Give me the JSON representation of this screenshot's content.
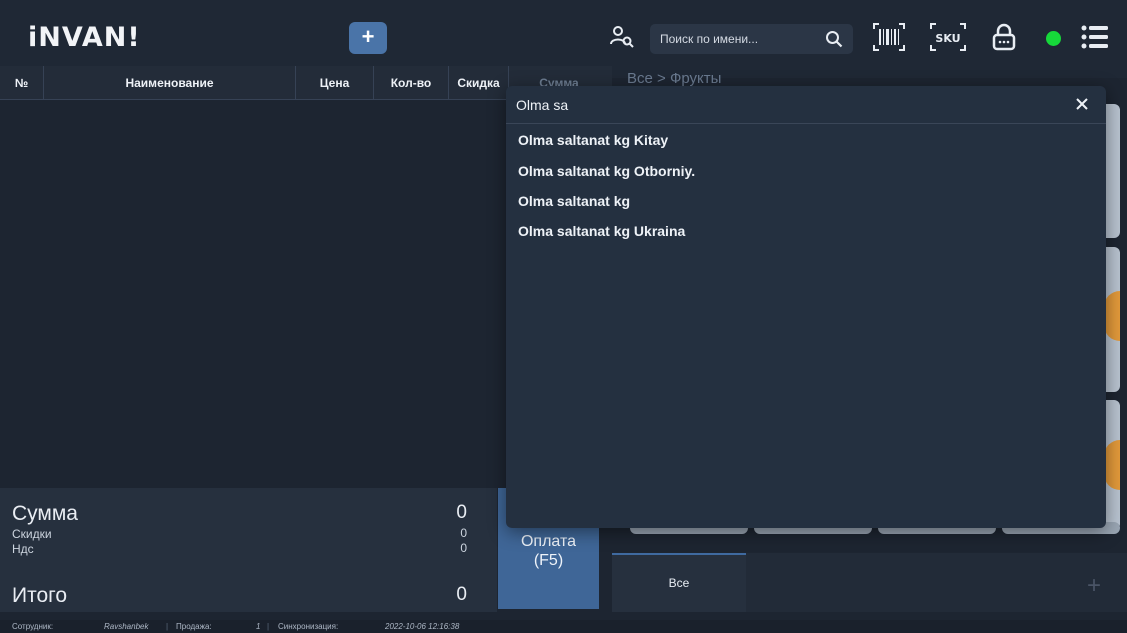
{
  "app": {
    "logo": "iNVAN!"
  },
  "header": {
    "add_label": "+",
    "search_placeholder": "Поиск по имени...",
    "icons": [
      "user-search-icon",
      "search-icon",
      "barcode-icon",
      "sku-icon",
      "lock-icon",
      "status-indicator",
      "menu-icon"
    ],
    "status_color": "#16d83a",
    "sku_label": "SKU"
  },
  "table": {
    "columns": [
      "№",
      "Наименование",
      "Цена",
      "Кол-во",
      "Скидка",
      "Сумма"
    ]
  },
  "breadcrumb": "Все > Фрукты",
  "totals": {
    "sum_label": "Сумма",
    "sum_value": "0",
    "discount_label": "Скидки",
    "discount_value": "0",
    "vat_label": "Ндс",
    "vat_value": "0",
    "total_label": "Итого",
    "total_value": "0"
  },
  "pay_button": {
    "line1": "Оплата",
    "line2": "(F5)"
  },
  "category_tabs": [
    "Все"
  ],
  "category_add": "+",
  "statusbar": {
    "employee_label": "Сотрудник:",
    "employee_value": "Ravshanbek",
    "sale_label": "Продажа:",
    "sale_value": "1",
    "sync_label": "Синхронизация:",
    "sync_value": "2022-10-06 12:16:38"
  },
  "search_overlay": {
    "query": "Olma sa",
    "results": [
      "Olma saltanat kg Kitay",
      "Olma saltanat kg Otborniy.",
      "Olma saltanat kg",
      "Olma saltanat kg Ukraina"
    ]
  },
  "colors": {
    "background": "#1d2531",
    "accent": "#3f6697",
    "overlay": "#243040"
  }
}
